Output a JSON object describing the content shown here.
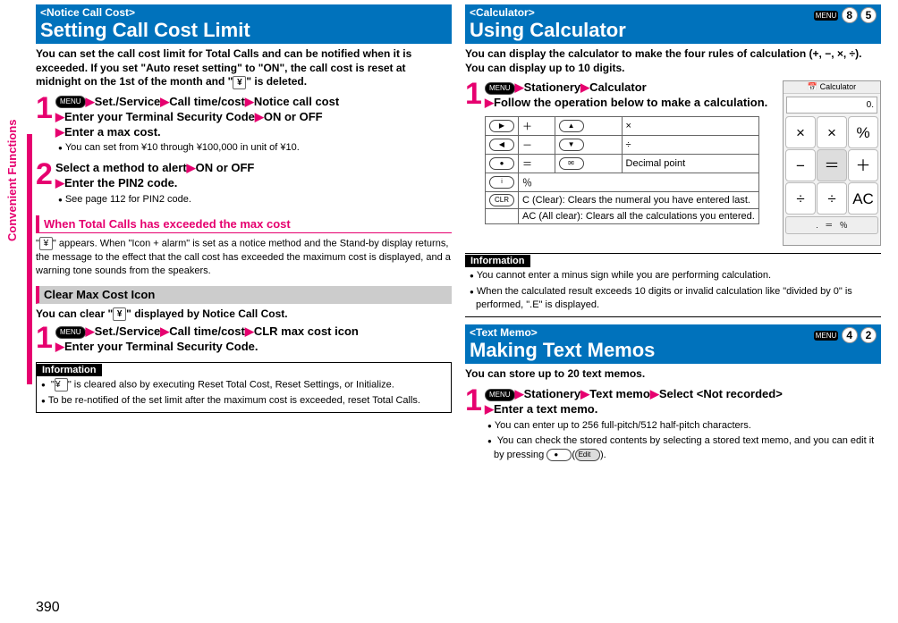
{
  "sideTab": "Convenient Functions",
  "pageNum": "390",
  "left": {
    "header": {
      "tag": "<Notice Call Cost>",
      "title": "Setting Call Cost Limit"
    },
    "intro": "You can set the call cost limit for Total Calls and can be notified when it is exceeded. If you set \"Auto reset setting\" to \"ON\", the call cost is reset at midnight on the 1st of the month and \"",
    "introEnd": "\" is deleted.",
    "step1": {
      "seq": [
        "Set./Service",
        "Call time/cost",
        "Notice call cost",
        "Enter your Terminal Security Code",
        "ON or OFF",
        "Enter a max cost."
      ],
      "bullet": "You can set from ¥10 through ¥100,000 in unit of ¥10."
    },
    "step2": {
      "title": "Select a method to alert",
      "seq": [
        "ON or OFF",
        "Enter the PIN2 code."
      ],
      "bullet": "See page 112 for PIN2 code."
    },
    "pinkSub1": "When Total Calls has exceeded the max cost",
    "pinkSub1Body": "\" appears. When \"Icon + alarm\" is set as a notice method and the Stand-by display returns, the message to the effect that the call cost has exceeded the maximum cost is displayed, and a warning tone sounds from the speakers.",
    "graySub": "Clear Max Cost Icon",
    "graySubIntro": "You can clear \"",
    "graySubIntroEnd": "\" displayed by Notice Call Cost.",
    "step3": {
      "seq": [
        "Set./Service",
        "Call time/cost",
        "CLR max cost icon",
        "Enter your Terminal Security Code."
      ]
    },
    "info": {
      "bullets": [
        "\" is cleared also by executing Reset Total Cost, Reset Settings, or Initialize.",
        "To be re-notified of the set limit after the maximum cost is exceeded, reset Total Calls."
      ],
      "prefix": "\""
    }
  },
  "right": {
    "calcHeader": {
      "tag": "<Calculator>",
      "title": "Using Calculator",
      "code": [
        "8",
        "5"
      ]
    },
    "calcIntro": "You can display the calculator to make the four rules of calculation (+, −, ×, ÷). You can display up to 10 digits.",
    "calcStep": {
      "seq": [
        "Stationery",
        "Calculator"
      ],
      "followLine": "Follow the operation below to make a calculation."
    },
    "calcTable": {
      "r1": [
        "＋",
        "×"
      ],
      "r2": [
        "－",
        "÷"
      ],
      "r3": [
        "＝",
        "Decimal point"
      ],
      "r4": [
        "％"
      ],
      "r5": "C (Clear): Clears the numeral you have entered last.",
      "r6": "AC (All clear): Clears all the calculations you entered."
    },
    "calcImg": {
      "title": "Calculator",
      "display": "0."
    },
    "calcInfo": [
      "You cannot enter a minus sign while you are performing calculation.",
      "When the calculated result exceeds 10 digits or invalid calculation like \"divided by 0\" is performed, \".E\" is displayed."
    ],
    "memoHeader": {
      "tag": "<Text Memo>",
      "title": "Making Text Memos",
      "code": [
        "4",
        "2"
      ]
    },
    "memoIntro": "You can store up to 20 text memos.",
    "memoStep": {
      "seq": [
        "Stationery",
        "Text memo",
        "Select <Not recorded>",
        "Enter a text memo."
      ]
    },
    "memoBullets": [
      "You can enter up to 256 full-pitch/512 half-pitch characters.",
      "You can check the stored contents by selecting a stored text memo, and you can edit it by pressing "
    ],
    "editLabel": "Edit",
    "memoBullet2End": "(          )."
  }
}
